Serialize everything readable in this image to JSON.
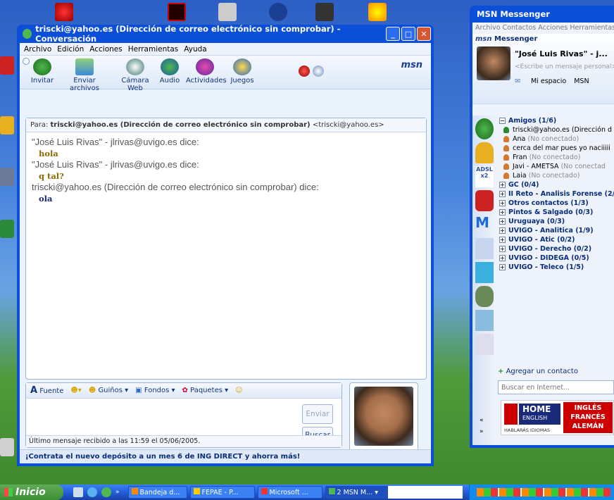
{
  "conv": {
    "title": "triscki@yahoo.es (Dirección de correo electrónico sin comprobar) - Conversación",
    "menu": [
      "Archivo",
      "Edición",
      "Acciones",
      "Herramientas",
      "Ayuda"
    ],
    "tools": [
      "Invitar",
      "Enviar archivos",
      "Cámara Web",
      "Audio",
      "Actividades",
      "Juegos"
    ],
    "msn_logo": "msn",
    "to_label": "Para:",
    "to_name": "triscki@yahoo.es (Dirección de correo electrónico sin comprobar)",
    "to_email": "<triscki@yahoo.es>",
    "messages": [
      {
        "said": "\"José Luis Rivas\" - jlrivas@uvigo.es dice:",
        "text": "hola",
        "color": "gold"
      },
      {
        "said": "\"José Luis Rivas\" - jlrivas@uvigo.es dice:",
        "text": "q tal?",
        "color": "gold"
      },
      {
        "said": "triscki@yahoo.es (Dirección de correo electrónico sin comprobar) dice:",
        "text": "ola",
        "color": "blue"
      }
    ],
    "compose_tools": [
      "Fuente",
      "Guiños",
      "Fondos",
      "Paquetes"
    ],
    "send": "Enviar",
    "search": "Buscar",
    "status": "Último mensaje recibido a las 11:59 el 05/06/2005.",
    "ad": "¡Contrata el nuevo depósito a un mes 6 de ING DIRECT y ahorra más!"
  },
  "messenger": {
    "title": "MSN Messenger",
    "menu": "Archivo  Contactos  Acciones  Herramientas",
    "brand": "Messenger",
    "user_name": "\"José Luis Rivas\" - j...",
    "personal_msg": "<Escribe un mensaje personal>",
    "links": [
      "Mi espacio",
      "MSN"
    ],
    "group_amigos": "Amigos (1/6)",
    "contacts": [
      {
        "name": "triscki@yahoo.es (Dirección d",
        "status": ""
      },
      {
        "name": "Ana",
        "status": "(No conectado)"
      },
      {
        "name": "cerca del mar pues yo naciiiii",
        "status": ""
      },
      {
        "name": "Fran",
        "status": "(No conectado)"
      },
      {
        "name": "Javi - AMETSA",
        "status": "(No conectad"
      },
      {
        "name": "Laia",
        "status": "(No conectado)"
      }
    ],
    "groups": [
      "GC (0/4)",
      "II Reto - Analisis Forense (2/",
      "Otros contactos (1/3)",
      "Pintos & Salgado (0/3)",
      "Uruguaya (0/3)",
      "UVIGO - Analitica (1/9)",
      "UVIGO - Atic (0/2)",
      "UVIGO - Derecho (0/2)",
      "UVIGO - DIDEGA (0/5)",
      "UVIGO - Teleco (1/5)"
    ],
    "add_contact": "Agregar un contacto",
    "search_placeholder": "Buscar en Internet...",
    "ad_brand": "HOME",
    "ad_sub": "ENGLISH",
    "ad_tagline": "HABLARÁS IDIOMAS",
    "ad_langs": [
      "INGLÉS",
      "FRANCÉS",
      "ALEMÁN"
    ]
  },
  "taskbar": {
    "start": "Inicio",
    "tasks": [
      "Bandeja d...",
      "FEPAE - P...",
      "Microsoft ...",
      "2 MSN M..."
    ]
  }
}
